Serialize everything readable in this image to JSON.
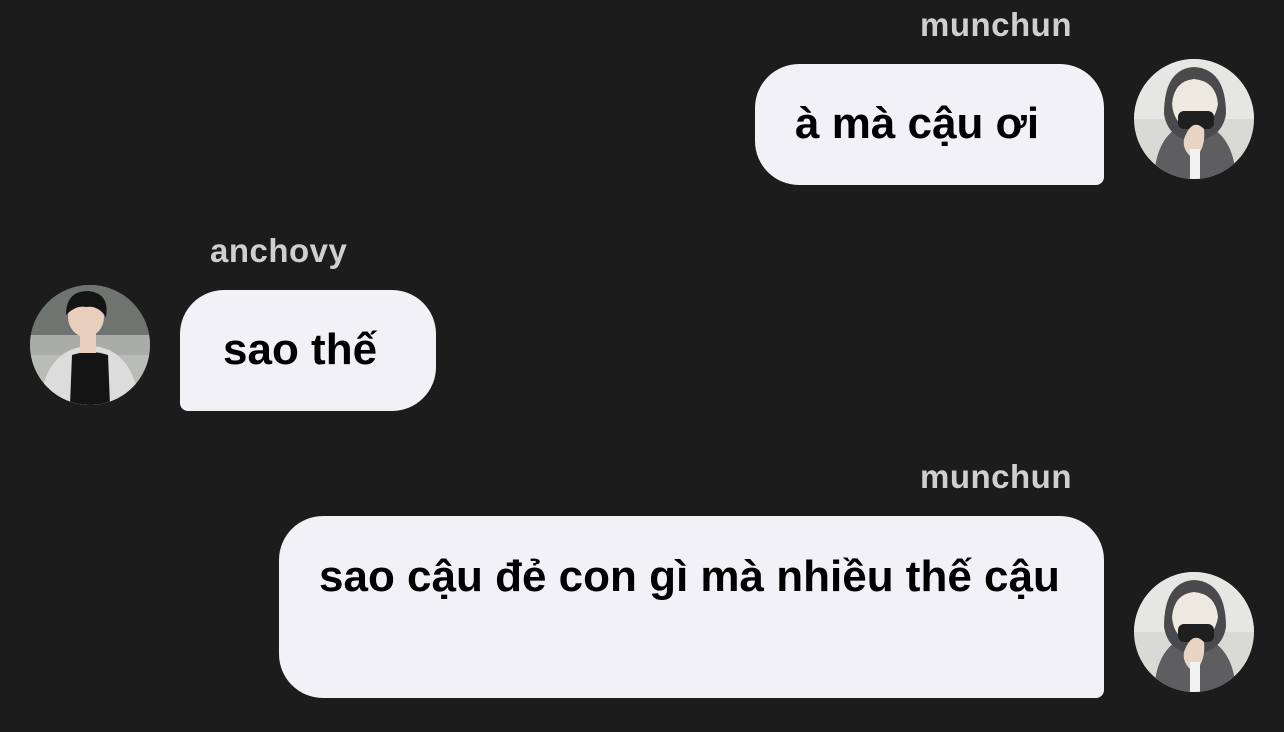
{
  "messages": [
    {
      "sender": "munchun",
      "text": "à mà cậu ơi",
      "direction": "outgoing",
      "avatar_icon": "hooded-person-avatar-icon"
    },
    {
      "sender": "anchovy",
      "text": "sao thế",
      "direction": "incoming",
      "avatar_icon": "person-avatar-icon"
    },
    {
      "sender": "munchun",
      "text": "sao cậu đẻ con gì mà nhiều thế cậu",
      "direction": "outgoing",
      "avatar_icon": "hooded-person-avatar-icon"
    }
  ],
  "colors": {
    "background": "#1c1c1d",
    "bubble": "#f2f1f6",
    "sender_name": "#cfcfd1",
    "text": "#000000"
  }
}
